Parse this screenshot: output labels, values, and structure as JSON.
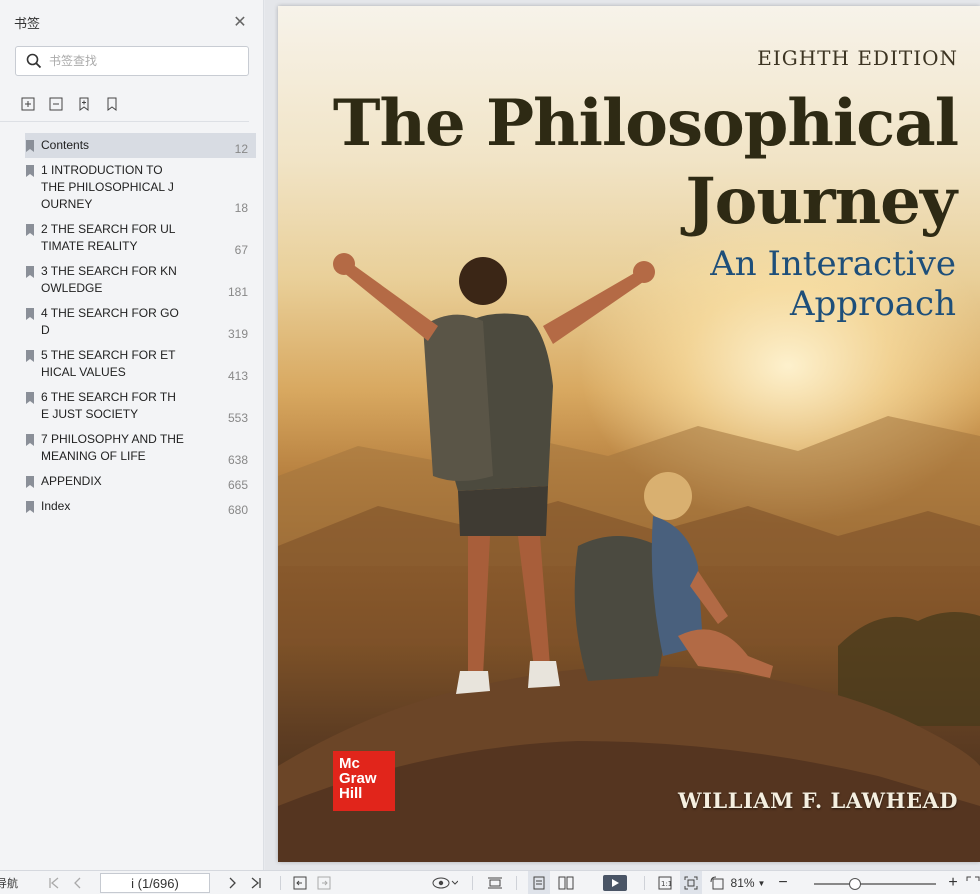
{
  "sidebar": {
    "title": "书签",
    "search_placeholder": "书签查找",
    "items": [
      {
        "label": "Contents",
        "page": "12"
      },
      {
        "label": "1 INTRODUCTION TO\nTHE PHILOSOPHICAL   J\nOURNEY",
        "page": "18"
      },
      {
        "label": "2 THE SEARCH FOR   UL\nTIMATE REALITY",
        "page": "67"
      },
      {
        "label": "3 THE SEARCH FOR   KN\nOWLEDGE",
        "page": "181"
      },
      {
        "label": "4 THE SEARCH   FOR GO\nD",
        "page": "319"
      },
      {
        "label": "5 THE SEARCH FOR   ET\nHICAL VALUES",
        "page": "413"
      },
      {
        "label": "6 THE SEARCH FOR   TH\nE JUST SOCIETY",
        "page": "553"
      },
      {
        "label": "7 PHILOSOPHY AND THE\nMEANING OF LIFE",
        "page": "638"
      },
      {
        "label": "APPENDIX",
        "page": "665"
      },
      {
        "label": "Index",
        "page": "680"
      }
    ]
  },
  "cover": {
    "edition": "EIGHTH EDITION",
    "title_line1": "The Philosophical",
    "title_line2": "Journey",
    "subtitle_line1": "An Interactive",
    "subtitle_line2": "Approach",
    "author": "WILLIAM F. LAWHEAD",
    "publisher_logo": "Mc Graw Hill"
  },
  "statusbar": {
    "nav_label": "导航",
    "page_indicator": "i (1/696)",
    "zoom": "81%"
  },
  "colors": {
    "title": "#2e2a14",
    "subtitle": "#1e4f7a",
    "logo": "#e1251b"
  }
}
